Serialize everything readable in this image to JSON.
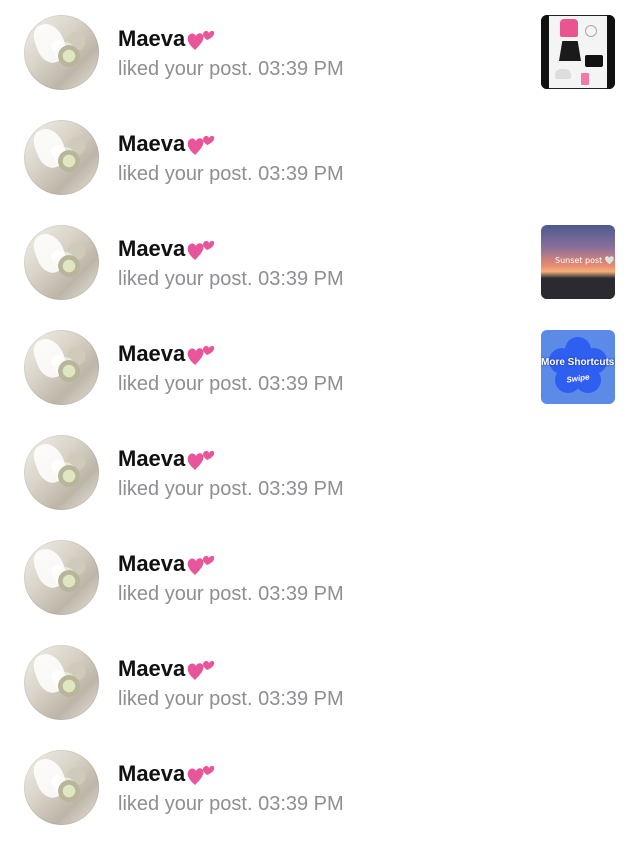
{
  "notifications": [
    {
      "name": "Maeva",
      "emoji": "💕",
      "action": "liked your post.",
      "time": "03:39 PM",
      "thumbnail": "outfit-collage"
    },
    {
      "name": "Maeva",
      "emoji": "💕",
      "action": "liked your post.",
      "time": "03:39 PM",
      "thumbnail": ""
    },
    {
      "name": "Maeva",
      "emoji": "💕",
      "action": "liked your post.",
      "time": "03:39 PM",
      "thumbnail": "sunset-photo",
      "thumbnail_caption": "Sunset post 🤍"
    },
    {
      "name": "Maeva",
      "emoji": "💕",
      "action": "liked your post.",
      "time": "03:39 PM",
      "thumbnail": "blue-flower-graphic",
      "thumbnail_text": "More Shortcuts!",
      "thumbnail_subtext": "Swipe"
    },
    {
      "name": "Maeva",
      "emoji": "💕",
      "action": "liked your post.",
      "time": "03:39 PM",
      "thumbnail": ""
    },
    {
      "name": "Maeva",
      "emoji": "💕",
      "action": "liked your post.",
      "time": "03:39 PM",
      "thumbnail": ""
    },
    {
      "name": "Maeva",
      "emoji": "💕",
      "action": "liked your post.",
      "time": "03:39 PM",
      "thumbnail": ""
    },
    {
      "name": "Maeva",
      "emoji": "💕",
      "action": "liked your post.",
      "time": "03:39 PM",
      "thumbnail": ""
    }
  ],
  "colors": {
    "name_text": "#111111",
    "subtitle_text": "#8e8e93",
    "heart": "#e9559a",
    "background": "#ffffff"
  }
}
